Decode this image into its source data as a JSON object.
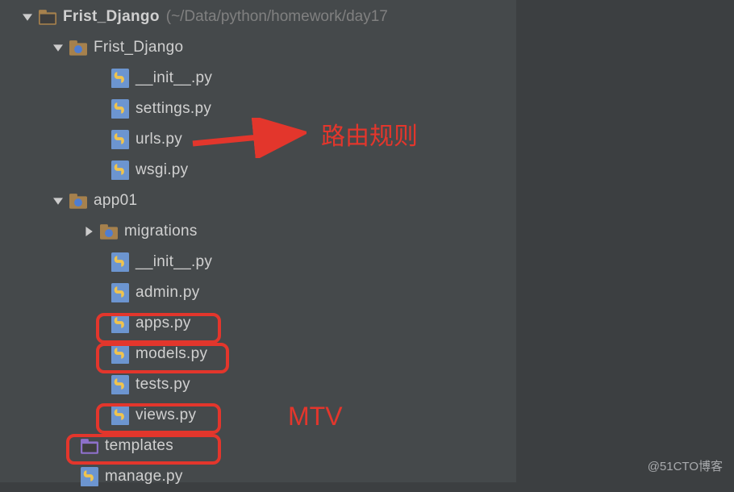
{
  "tree": {
    "root": {
      "label": "Frist_Django",
      "path": "~/Data/python/homework/day17"
    },
    "pkg": {
      "label": "Frist_Django",
      "init": "__init__.py",
      "settings": "settings.py",
      "urls": "urls.py",
      "wsgi": "wsgi.py"
    },
    "app": {
      "label": "app01",
      "migrations": "migrations",
      "init": "__init__.py",
      "admin": "admin.py",
      "apps": "apps.py",
      "models": "models.py",
      "tests": "tests.py",
      "views": "views.py"
    },
    "templates": "templates",
    "manage": "manage.py"
  },
  "annot": {
    "routing": "路由规则",
    "mtv": "MTV"
  },
  "watermark": "@51CTO博客"
}
